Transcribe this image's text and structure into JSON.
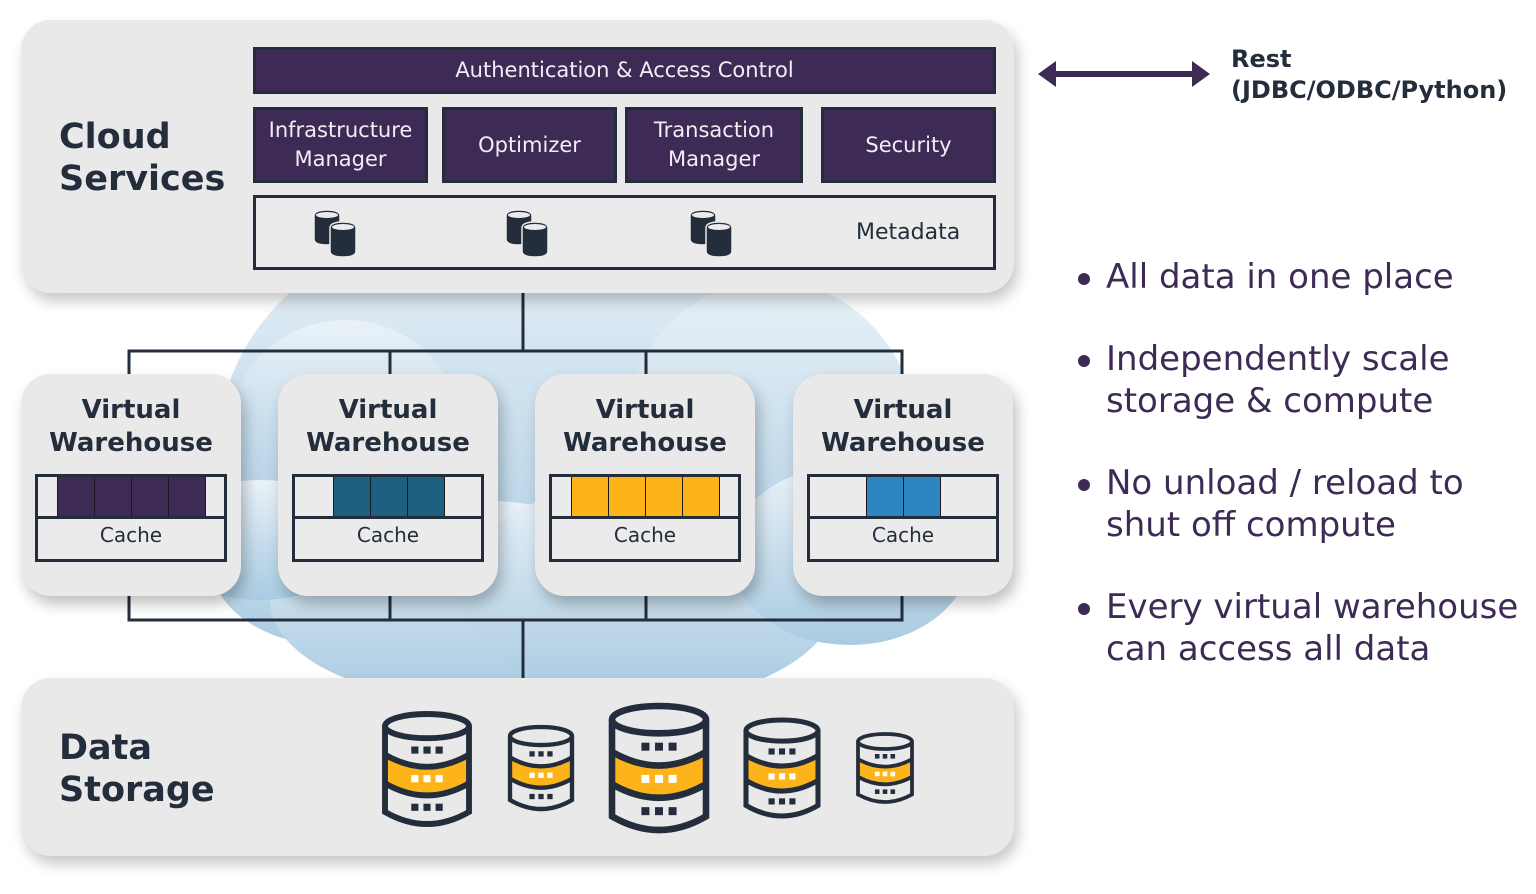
{
  "colors": {
    "purple": "#3d2b56",
    "dark_navy": "#232d3b",
    "panel_gray": "#e9e9e9",
    "cloud_blue": "#b3d0e5",
    "teal_blue": "#1f5f82",
    "amber": "#fdb41a",
    "bright_blue": "#2e86c1"
  },
  "cloud_services": {
    "title_line1": "Cloud",
    "title_line2": "Services",
    "auth_bar": "Authentication & Access Control",
    "components": [
      {
        "line1": "Infrastructure",
        "line2": "Manager"
      },
      {
        "line1": "Optimizer",
        "line2": ""
      },
      {
        "line1": "Transaction",
        "line2": "Manager"
      },
      {
        "line1": "Security",
        "line2": ""
      }
    ],
    "metadata_label": "Metadata",
    "metadata_icons": [
      "database-stack-icon",
      "database-stack-icon",
      "database-stack-icon"
    ]
  },
  "rest": {
    "line1": "Rest",
    "line2": "(JDBC/ODBC/Python)",
    "icon": "double-arrow-icon"
  },
  "warehouses": [
    {
      "title_line1": "Virtual",
      "title_line2": "Warehouse",
      "cache_label": "Cache",
      "slots": 4,
      "color": "#3d2b56"
    },
    {
      "title_line1": "Virtual",
      "title_line2": "Warehouse",
      "cache_label": "Cache",
      "slots": 3,
      "color": "#1f5f82"
    },
    {
      "title_line1": "Virtual",
      "title_line2": "Warehouse",
      "cache_label": "Cache",
      "slots": 4,
      "color": "#fdb41a"
    },
    {
      "title_line1": "Virtual",
      "title_line2": "Warehouse",
      "cache_label": "Cache",
      "slots": 2,
      "color": "#2e86c1"
    }
  ],
  "data_storage": {
    "title_line1": "Data",
    "title_line2": "Storage",
    "database_icons": 5
  },
  "bullets": [
    {
      "line1": "All data in one place",
      "line2": ""
    },
    {
      "line1": "Independently scale",
      "line2": "storage & compute"
    },
    {
      "line1": "No unload / reload to",
      "line2": "shut off compute"
    },
    {
      "line1": "Every virtual warehouse",
      "line2": "can access all data"
    }
  ]
}
